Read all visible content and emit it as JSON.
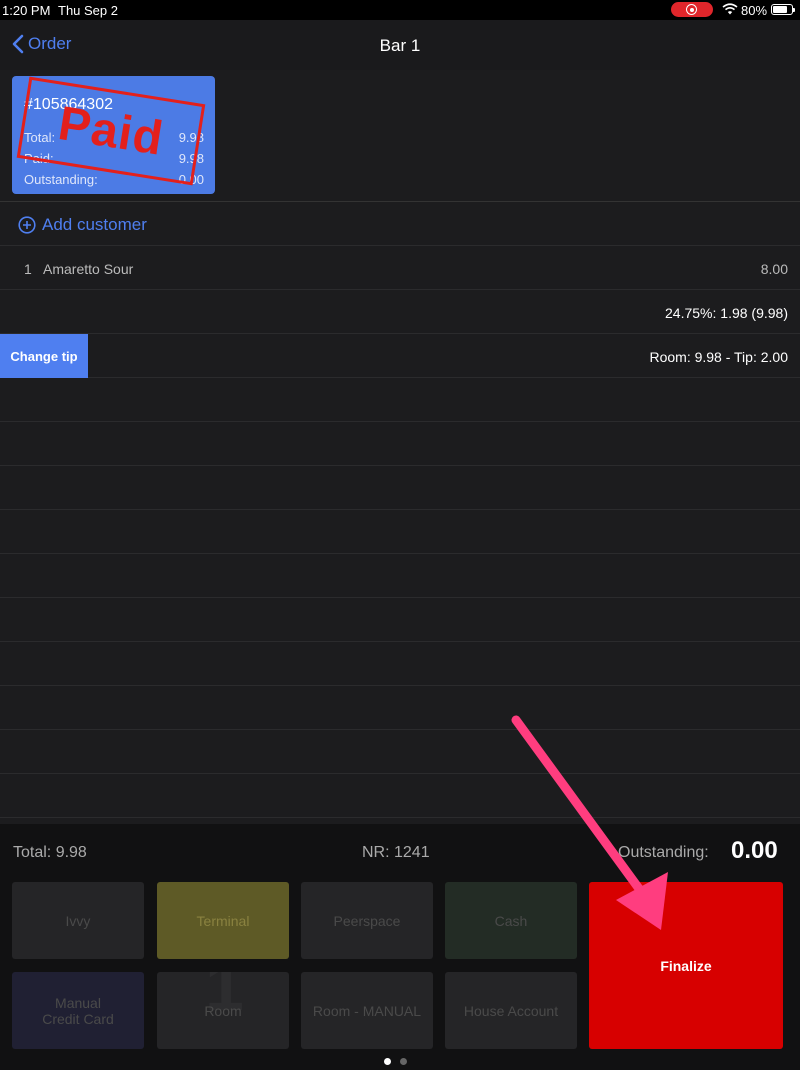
{
  "status_bar": {
    "time": "1:20 PM",
    "date": "Thu Sep 2",
    "battery": "80%",
    "battery_fraction": 0.8
  },
  "nav": {
    "back_label": "Order",
    "title": "Bar 1"
  },
  "order_card": {
    "number": "#105864302",
    "total_label": "Total:",
    "total_value": "9.98",
    "paid_label": "Paid:",
    "paid_value": "9.98",
    "outstanding_label": "Outstanding:",
    "outstanding_value": "0.00",
    "stamp": "Paid"
  },
  "add_customer": "Add customer",
  "items": [
    {
      "qty": "1",
      "name": "Amaretto Sour",
      "price": "8.00"
    }
  ],
  "tip_summary": "24.75%: 1.98 (9.98)",
  "room_row": {
    "button": "Change tip",
    "summary": "Room: 9.98  - Tip: 2.00"
  },
  "totals": {
    "total": "Total: 9.98",
    "nr": "NR: 1241",
    "outstanding_label": "Outstanding:",
    "outstanding_value": "0.00"
  },
  "payment_buttons": {
    "ivvy": "Ivvy",
    "terminal": "Terminal",
    "peerspace": "Peerspace",
    "cash": "Cash",
    "manual_line1": "Manual",
    "manual_line2": "Credit Card",
    "room": "Room",
    "room_ghost": "1",
    "room_manual": "Room - MANUAL",
    "house_account": "House Account"
  },
  "finalize": "Finalize",
  "colors": {
    "accent": "#4f7ff0",
    "finalize": "#d70000",
    "stamp": "#e3201c",
    "arrow": "#ff3d7f"
  }
}
